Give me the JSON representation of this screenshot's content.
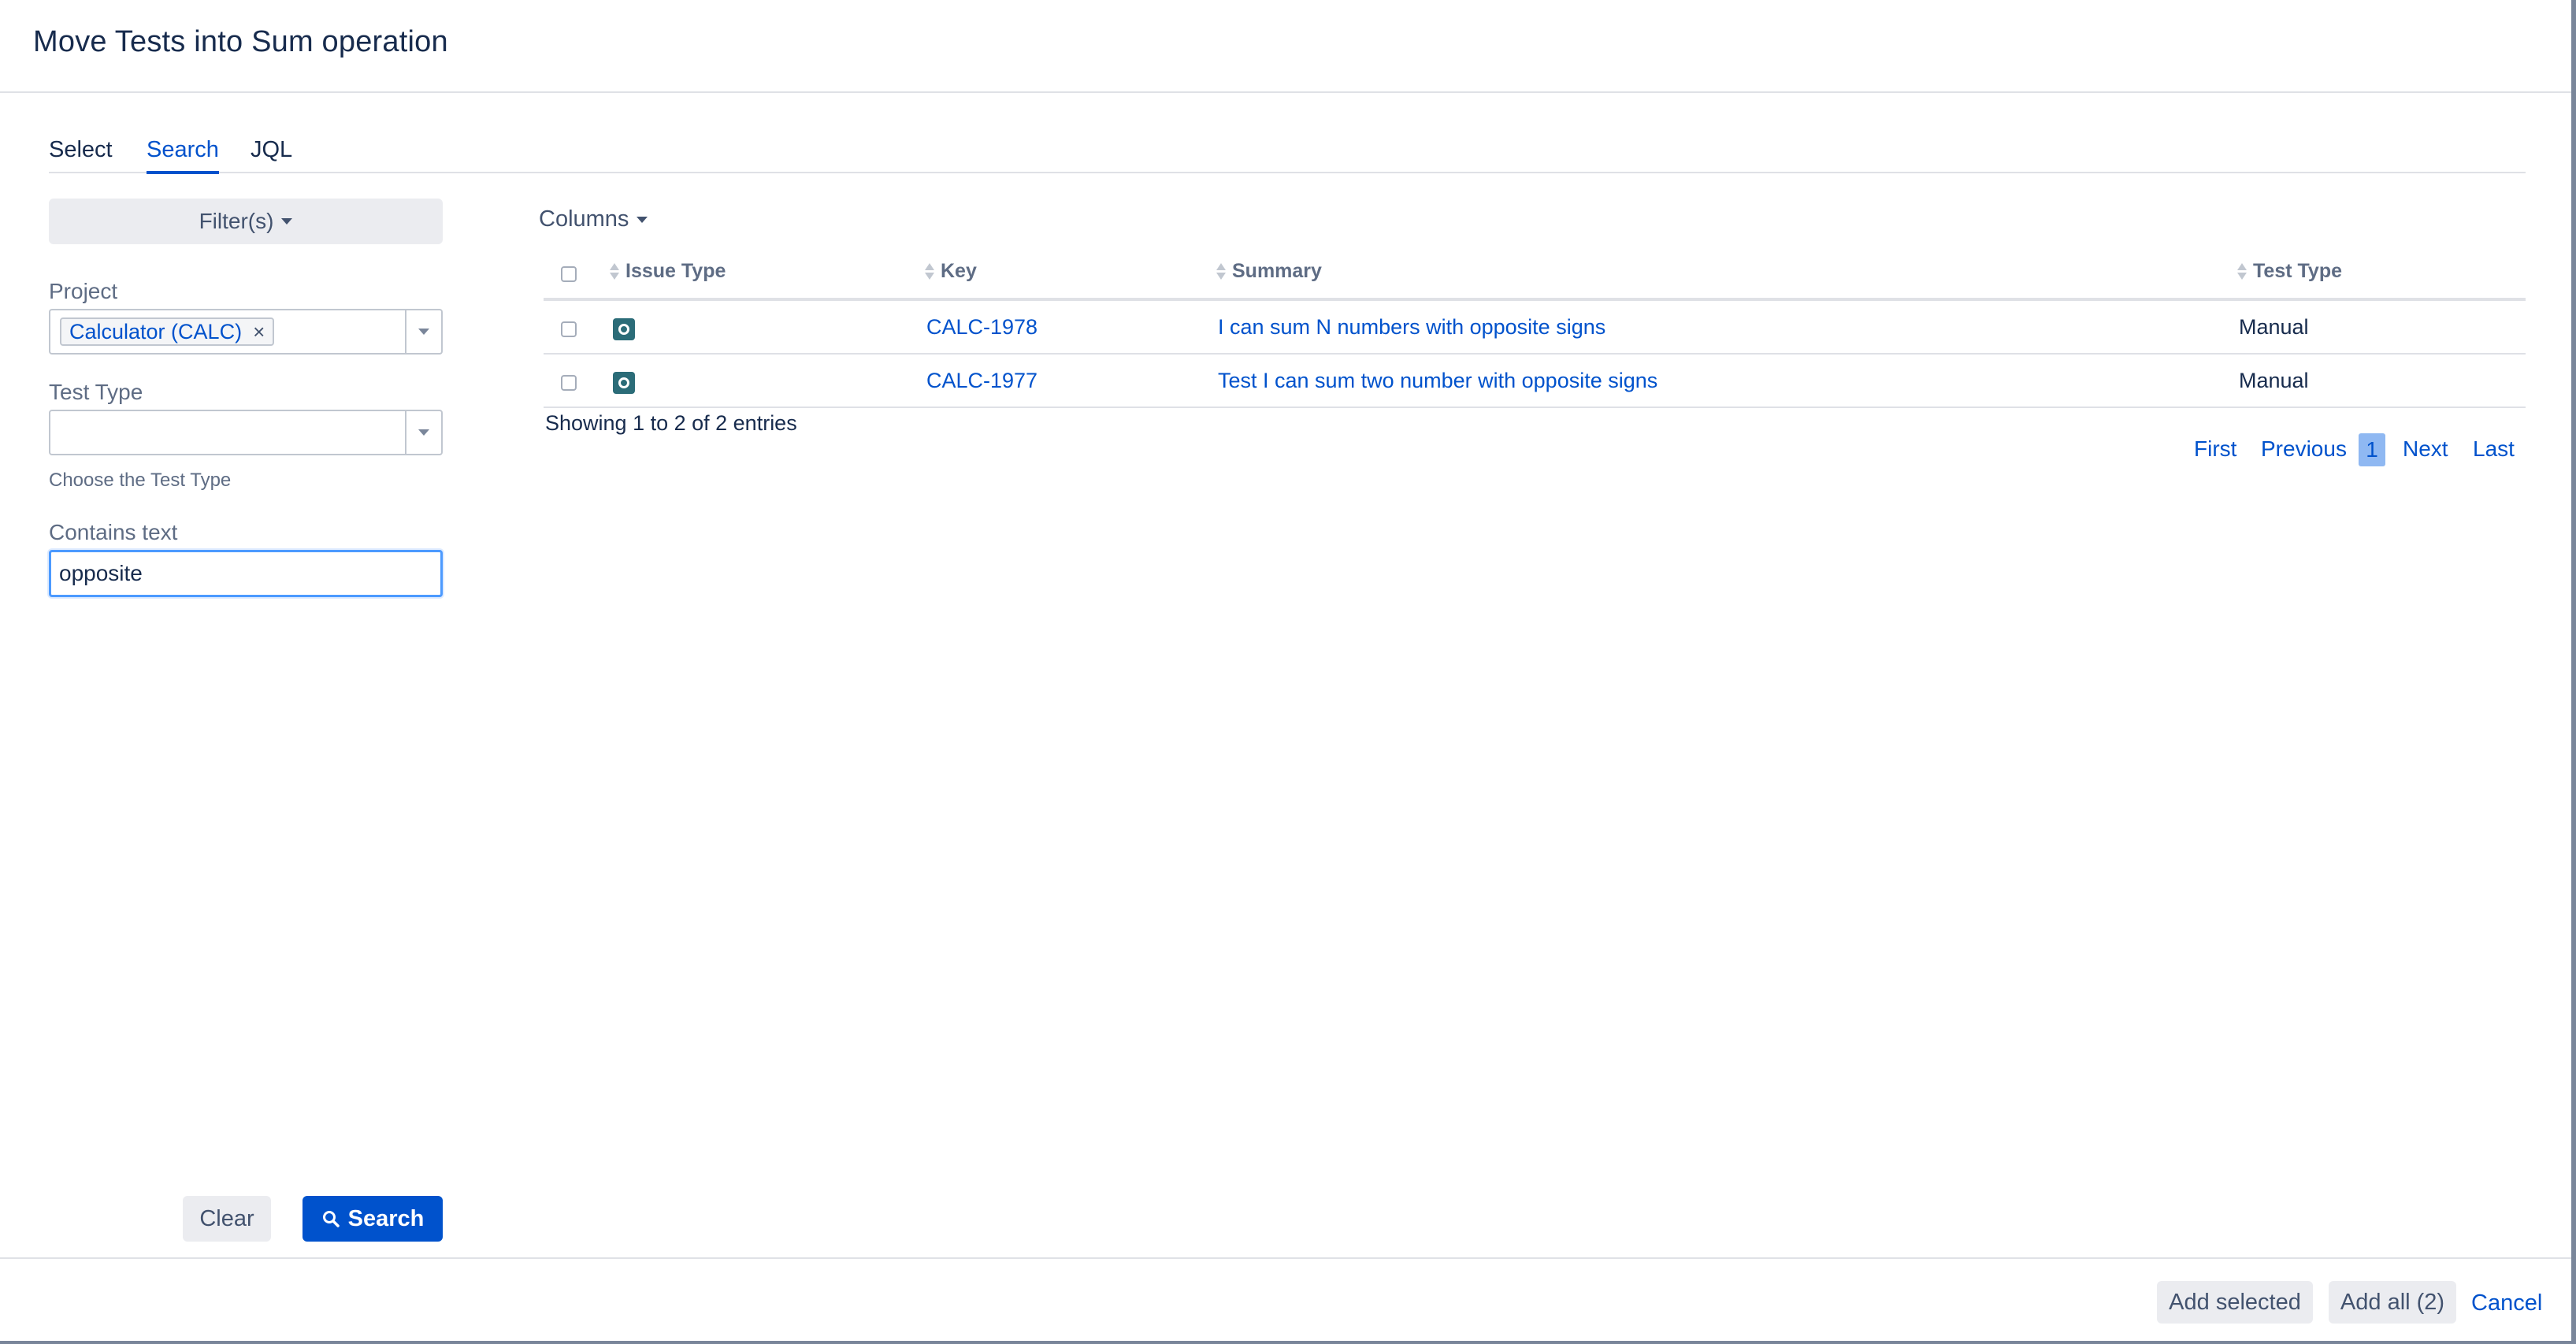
{
  "dialog": {
    "title": "Move Tests into Sum operation"
  },
  "tabs": [
    {
      "label": "Select",
      "active": false
    },
    {
      "label": "Search",
      "active": true
    },
    {
      "label": "JQL",
      "active": false
    }
  ],
  "filters": {
    "filters_button": "Filter(s)",
    "project_label": "Project",
    "project_value": "Calculator (CALC)",
    "remove_glyph": "×",
    "test_type_label": "Test Type",
    "test_type_value": "",
    "test_type_help": "Choose the Test Type",
    "contains_text_label": "Contains text",
    "contains_text_value": "opposite",
    "clear_button": "Clear",
    "search_button": "Search"
  },
  "results": {
    "columns_button": "Columns",
    "headers": {
      "issue_type": "Issue Type",
      "key": "Key",
      "summary": "Summary",
      "test_type": "Test Type"
    },
    "rows": [
      {
        "issue_type_icon": "test-issue-icon",
        "key": "CALC-1978",
        "summary": "I can sum N numbers with opposite signs",
        "test_type": "Manual"
      },
      {
        "issue_type_icon": "test-issue-icon",
        "key": "CALC-1977",
        "summary": "Test I can sum two number with opposite signs",
        "test_type": "Manual"
      }
    ],
    "showing_text": "Showing 1 to 2 of 2 entries",
    "pagination": {
      "first": "First",
      "previous": "Previous",
      "current": "1",
      "next": "Next",
      "last": "Last"
    }
  },
  "footer": {
    "add_selected": "Add selected",
    "add_all": "Add all (2)",
    "cancel": "Cancel"
  },
  "colors": {
    "primary": "#0052cc",
    "link": "#0052cc",
    "text": "#172b4d",
    "muted": "#5e6c84",
    "button_bg": "#ebecf0",
    "focus_border": "#4c9aff",
    "test_icon": "#2b6c78",
    "page_highlight": "#8fb8f2"
  }
}
